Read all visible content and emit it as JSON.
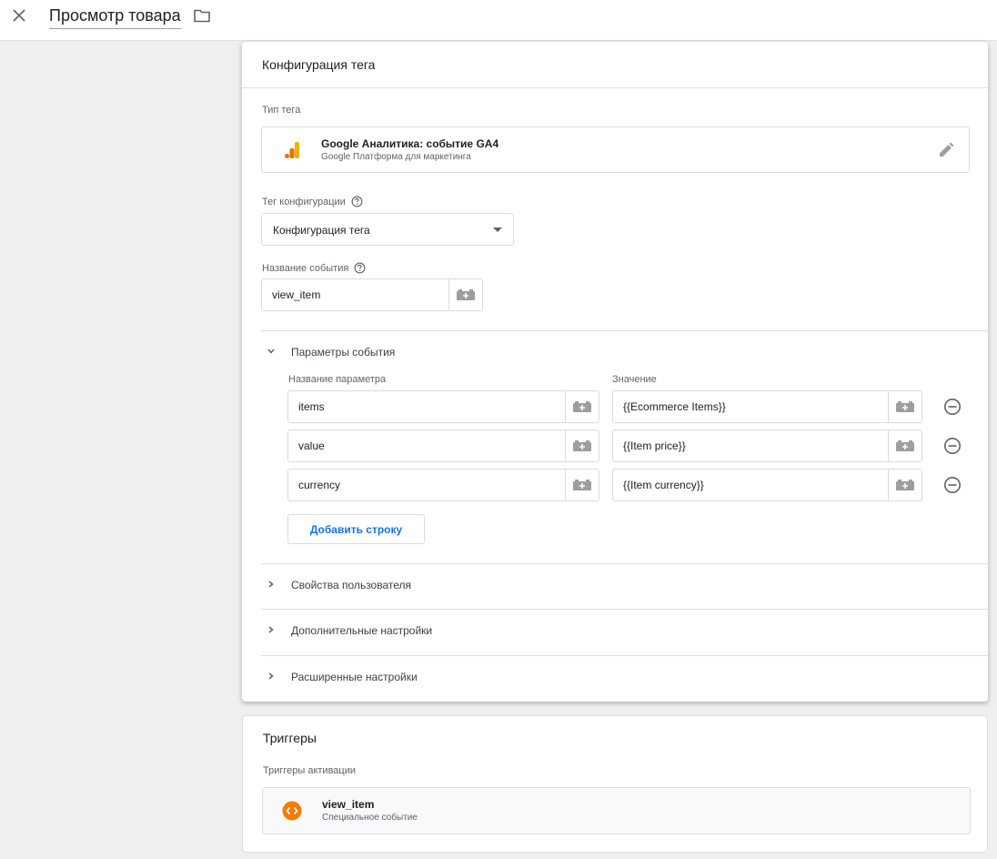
{
  "header": {
    "title": "Просмотр товара"
  },
  "config": {
    "title": "Конфигурация тега",
    "tag_type_label": "Тип тега",
    "tag_type_name": "Google Аналитика: событие GA4",
    "tag_type_sub": "Google Платформа для маркетинга",
    "config_tag_label": "Тег конфигурации",
    "config_tag_value": "Конфигурация тега",
    "event_name_label": "Название события",
    "event_name_value": "view_item",
    "params_section_label": "Параметры события",
    "param_name_header": "Название параметра",
    "param_value_header": "Значение",
    "params": [
      {
        "name": "items",
        "value": "{{Ecommerce Items}}"
      },
      {
        "name": "value",
        "value": "{{Item price}}"
      },
      {
        "name": "currency",
        "value": "{{Item currency}}"
      }
    ],
    "add_row_label": "Добавить строку",
    "sections": [
      {
        "label": "Свойства пользователя"
      },
      {
        "label": "Дополнительные настройки"
      },
      {
        "label": "Расширенные настройки"
      }
    ]
  },
  "triggers": {
    "title": "Триггеры",
    "firing_label": "Триггеры активации",
    "trigger_name": "view_item",
    "trigger_sub": "Специальное событие"
  },
  "colors": {
    "accent_blue": "#1a73e8",
    "ga_orange": "#f9ab00",
    "ga_dark_orange": "#e37400",
    "trigger_orange": "#f57c00"
  }
}
